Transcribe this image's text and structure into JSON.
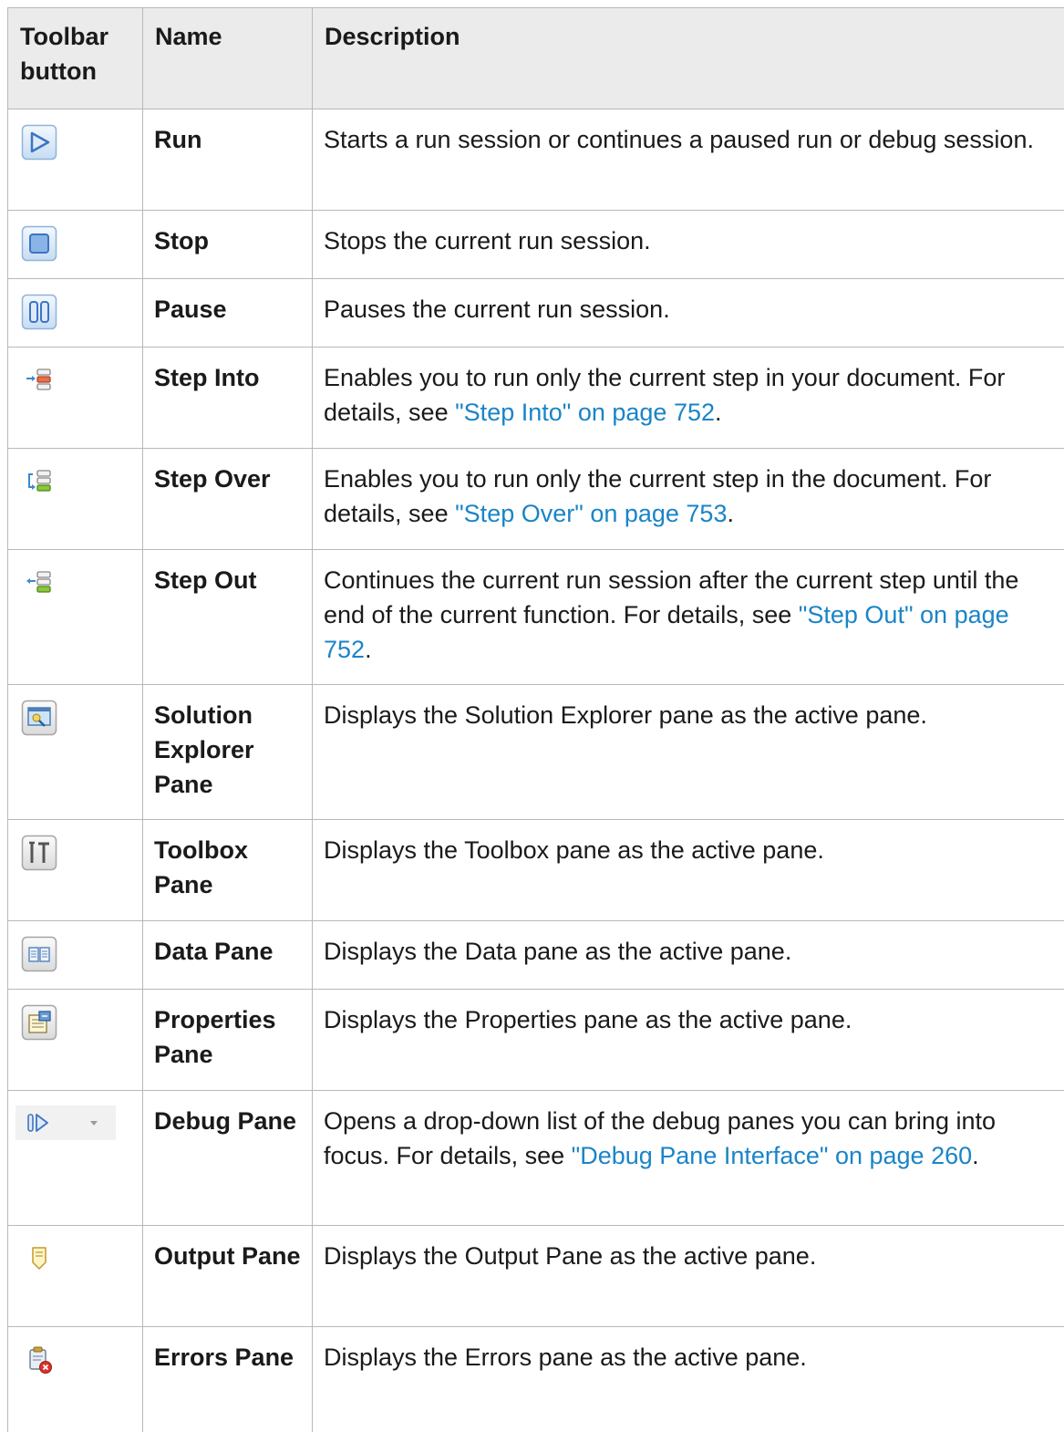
{
  "headers": {
    "toolbar_button": "Toolbar button",
    "name": "Name",
    "description": "Description"
  },
  "rows": [
    {
      "icon": "run-icon",
      "name": "Run",
      "desc": "Starts a run session or continues a paused run or debug session."
    },
    {
      "icon": "stop-icon",
      "name": "Stop",
      "desc": "Stops the current run session."
    },
    {
      "icon": "pause-icon",
      "name": "Pause",
      "desc": "Pauses the current run session."
    },
    {
      "icon": "step-into-icon",
      "name": "Step Into",
      "desc_pre": "Enables you to run only the current step in your document. For details, see ",
      "link": "\"Step Into\" on page 752",
      "desc_post": "."
    },
    {
      "icon": "step-over-icon",
      "name": "Step Over",
      "desc_pre": "Enables you to run only the current step in the document. For details, see ",
      "link": "\"Step Over\" on page 753",
      "desc_post": "."
    },
    {
      "icon": "step-out-icon",
      "name": "Step Out",
      "desc_pre": "Continues the current run session after the current step until the end of the current function. For details, see ",
      "link": "\"Step Out\" on page 752",
      "desc_post": "."
    },
    {
      "icon": "solution-explorer-icon",
      "name": "Solution Explorer Pane",
      "desc": "Displays the Solution Explorer pane as the active pane."
    },
    {
      "icon": "toolbox-icon",
      "name": "Toolbox Pane",
      "desc": "Displays the Toolbox pane as the active pane."
    },
    {
      "icon": "data-pane-icon",
      "name": "Data Pane",
      "desc": "Displays the Data pane as the active pane."
    },
    {
      "icon": "properties-icon",
      "name": "Properties Pane",
      "desc": "Displays the Properties pane as the active pane."
    },
    {
      "icon": "debug-pane-icon",
      "name": "Debug Pane",
      "desc_pre": "Opens a drop-down list of the debug panes you can bring into focus. For details, see ",
      "link": "\"Debug Pane Interface\" on page 260",
      "desc_post": "."
    },
    {
      "icon": "output-pane-icon",
      "name": "Output Pane",
      "desc": "Displays the Output Pane as the active pane."
    },
    {
      "icon": "errors-pane-icon",
      "name": "Errors Pane",
      "desc": "Displays the Errors pane as the active pane."
    }
  ],
  "colors": {
    "link": "#1a84c7",
    "header_bg": "#ebebeb",
    "border": "#b8b8b8"
  }
}
